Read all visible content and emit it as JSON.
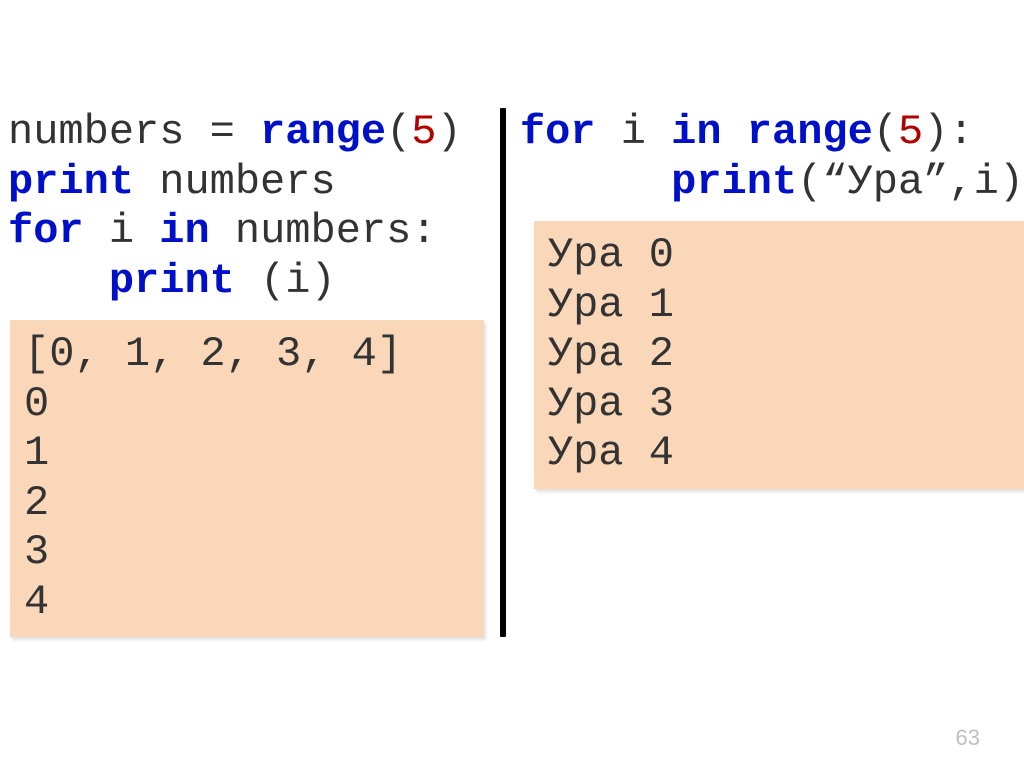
{
  "page_number": "63",
  "left": {
    "code": {
      "l1a": "numbers = ",
      "l1b": "range",
      "l1c": "(",
      "l1d": "5",
      "l1e": ")",
      "l2a": "print",
      "l2b": " numbers",
      "l3a": "for",
      "l3b": " i ",
      "l3c": "in",
      "l3d": " numbers:",
      "l4a": "    ",
      "l4b": "print",
      "l4c": " (i)"
    },
    "output": "[0, 1, 2, 3, 4]\n0\n1\n2\n3\n4"
  },
  "right": {
    "code": {
      "l1a": "for",
      "l1b": " i ",
      "l1c": "in",
      "l1d": " ",
      "l1e": "range",
      "l1f": "(",
      "l1g": "5",
      "l1h": "):",
      "l2a": "      ",
      "l2b": "print",
      "l2c": "(“Ура”,i)"
    },
    "output": "Ура 0\nУра 1\nУра 2\nУра 3\nУра 4"
  }
}
